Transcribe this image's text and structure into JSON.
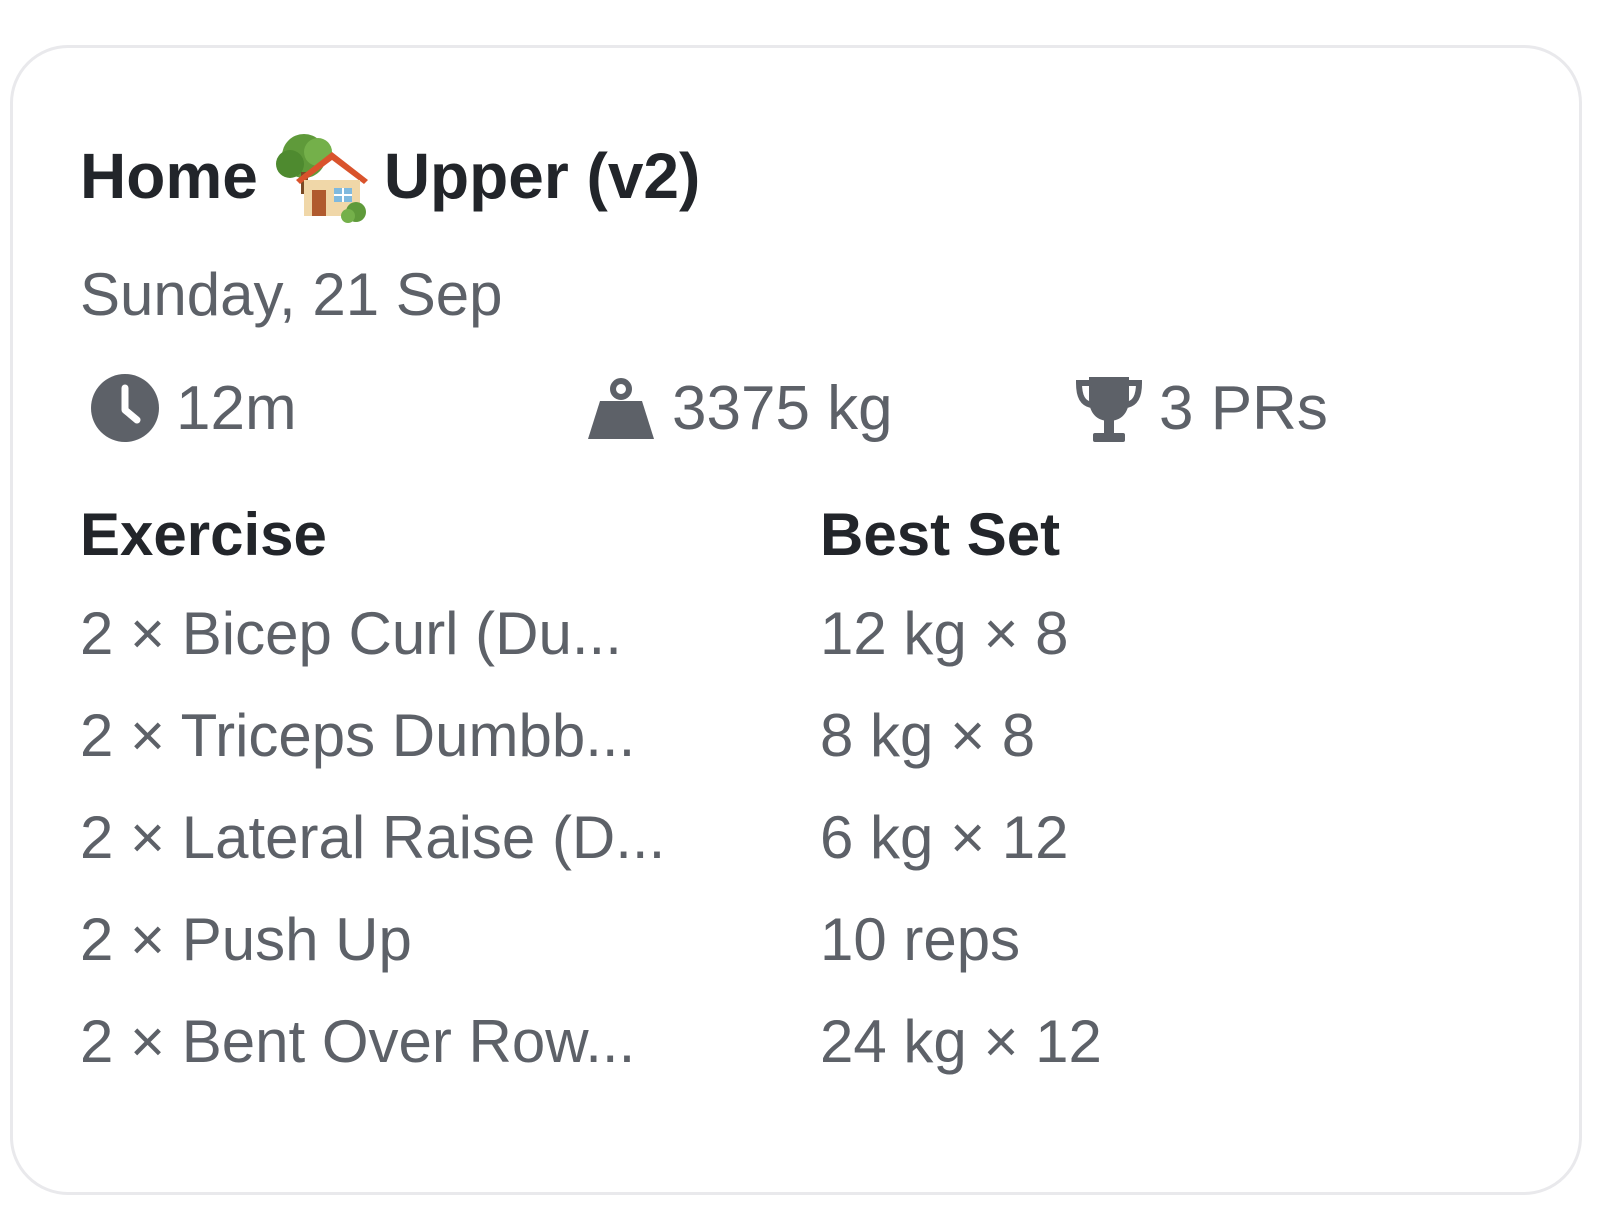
{
  "workout": {
    "title_start": "Home",
    "title_emoji": "house-with-garden-icon",
    "title_end": "Upper (v2)",
    "date": "Sunday, 21 Sep"
  },
  "stats": {
    "duration": "12m",
    "volume": "3375 kg",
    "prs": "3 PRs"
  },
  "table": {
    "headers": [
      "Exercise",
      "Best Set"
    ],
    "rows": [
      {
        "exercise": "2 × Bicep Curl (Du...",
        "best_set": "12 kg × 8"
      },
      {
        "exercise": "2 × Triceps Dumbb...",
        "best_set": "8 kg × 8"
      },
      {
        "exercise": "2 × Lateral Raise (D...",
        "best_set": "6 kg × 12"
      },
      {
        "exercise": "2 × Push Up",
        "best_set": "10 reps"
      },
      {
        "exercise": "2 × Bent Over Row...",
        "best_set": "24 kg × 12"
      }
    ]
  },
  "colors": {
    "title_text": "#22252a",
    "secondary_text": "#5d6168",
    "card_border": "#e9e9ec"
  }
}
